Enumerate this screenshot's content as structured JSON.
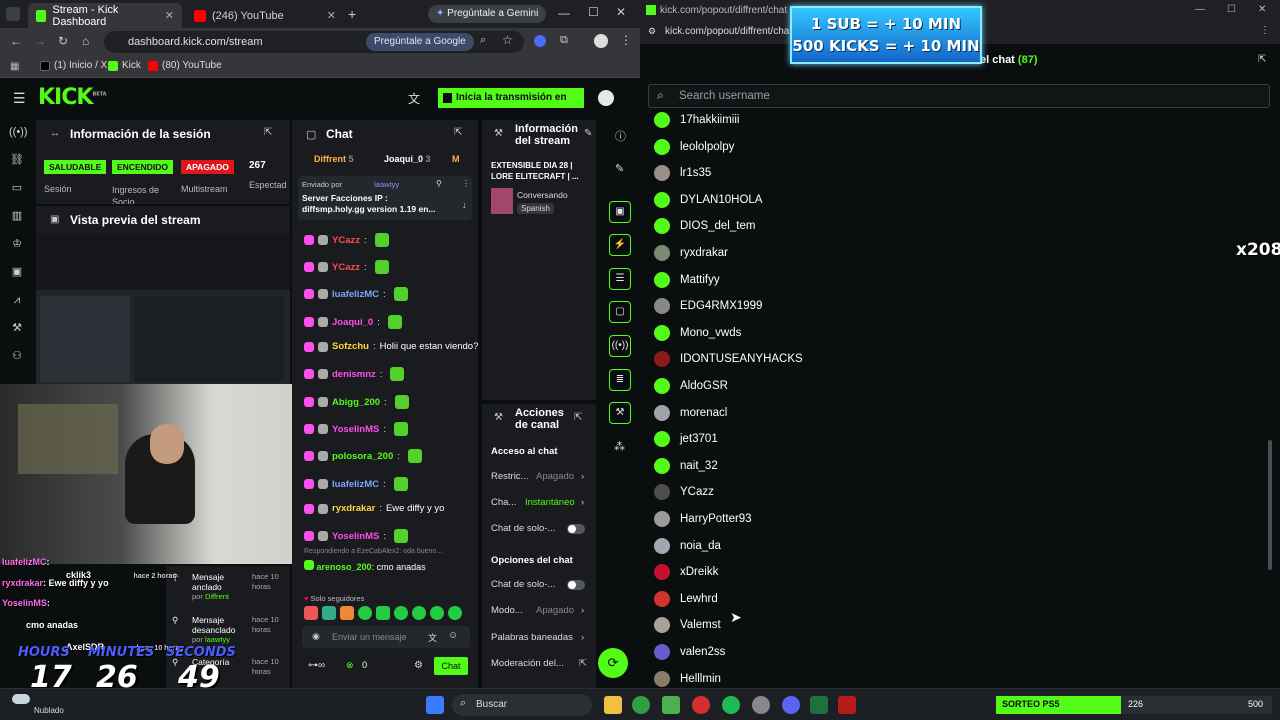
{
  "left_browser": {
    "tabs": [
      {
        "label": "Stream - Kick Dashboard",
        "icon": "kick-icon"
      },
      {
        "label": "(246) YouTube",
        "icon": "youtube-icon"
      }
    ],
    "gemini_label": "Pregúntale a Gemini",
    "url": "dashboard.kick.com/stream",
    "google_label": "Pregúntale a Google",
    "bookmarks": [
      "(1) Inicio / X",
      "Kick",
      "(80) YouTube"
    ]
  },
  "kick": {
    "logo": "KICK",
    "logo_tag": "BETA",
    "live_button": "Inicia la transmisión en directo",
    "session": {
      "title": "Información de la sesión",
      "badges": [
        {
          "label": "SALUDABLE",
          "caption": "Sesión",
          "color": "#53fc18"
        },
        {
          "label": "ENCENDIDO",
          "caption": "Ingresos de Socio",
          "color": "#53fc18"
        },
        {
          "label": "APAGADO",
          "caption": "Multistream",
          "color": "#e0161d"
        }
      ],
      "viewers": "267",
      "viewers_caption": "Espectad"
    },
    "preview_title": "Vista previa del stream",
    "chat": {
      "title": "Chat",
      "top_users": [
        {
          "name": "Diffrent",
          "count": "5"
        },
        {
          "name": "Joaqui_0",
          "count": "3"
        },
        {
          "name": "M",
          "count": ""
        }
      ],
      "pinned_by": "Enviado por",
      "pinned_user": "laawtyy",
      "pinned_text": "Server Facciones IP : diffsmp.holy.gg version 1.19 en...",
      "messages": [
        {
          "user": "YCazz",
          "text": "",
          "color": "#ff4d4d"
        },
        {
          "user": "YCazz",
          "text": "",
          "color": "#ff4d4d"
        },
        {
          "user": "luafelizMC",
          "text": "",
          "color": "#7da7ff"
        },
        {
          "user": "Joaqui_0",
          "text": "",
          "color": "#ff4df0"
        },
        {
          "user": "Sofzchu",
          "text": "Holii que estan viendo?",
          "color": "#ffd93b"
        },
        {
          "user": "denismnz",
          "text": "",
          "color": "#ff4df0"
        },
        {
          "user": "Abigg_200",
          "text": "",
          "color": "#53fc18"
        },
        {
          "user": "YoselinMS",
          "text": "",
          "color": "#ff4df0"
        },
        {
          "user": "polosora_200",
          "text": "",
          "color": "#53fc18"
        },
        {
          "user": "luafelizMC",
          "text": "",
          "color": "#7da7ff"
        },
        {
          "user": "ryxdrakar",
          "text": "Ewe diffy y yo",
          "color": "#ffd93b"
        },
        {
          "user": "YoselinMS",
          "text": "",
          "color": "#ff4df0"
        }
      ],
      "reply_context": "Respondiendo a EzeCabAlex2: oda bueno...",
      "reply_user": "arenoso_200",
      "reply_text": "cmo anadas",
      "followers_only": "Solo seguidores",
      "input_placeholder": "Enviar un mensaje",
      "points": "0",
      "send_label": "Chat"
    },
    "stream_info": {
      "title": "Información del stream",
      "stream_title": "EXTENSIBLE DIA 28 | LORE ELITECRAFT | ...",
      "category": "Conversando",
      "language": "Spanish"
    },
    "actions": {
      "title": "Acciones de canal",
      "access_title": "Acceso al chat",
      "rows": [
        {
          "label": "Restric...",
          "value": "Apagado"
        },
        {
          "label": "Cha...",
          "value": "Instantáneo"
        }
      ],
      "subs_label": "Chat de solo-...",
      "options_title": "Opciones del chat",
      "opt_rows": [
        {
          "label": "Chat de solo-...",
          "value": ""
        },
        {
          "label": "Modo...",
          "value": "Apagado"
        },
        {
          "label": "Palabras baneadas",
          "value": ""
        },
        {
          "label": "Moderación del...",
          "value": ""
        }
      ]
    },
    "activity": [
      {
        "title": "Mensaje anclado",
        "by": "por",
        "user": "Diffrent",
        "time": "hace 10 horas"
      },
      {
        "title": "Mensaje desanclado",
        "by": "por",
        "user": "laawtyy",
        "time": "hace 10 horas"
      },
      {
        "title": "Categoría",
        "by": "",
        "user": "",
        "time": "hace 10 horas"
      }
    ]
  },
  "overlay": {
    "messages": [
      {
        "user": "luafelizMC",
        "text": ""
      },
      {
        "user": "ryxdrakar",
        "text": "Ewe diffy y yo"
      },
      {
        "user": "YoselinMS",
        "text": ""
      },
      {
        "user": "",
        "text": "cmo anadas"
      }
    ],
    "side_messages": [
      {
        "user": "cklik3",
        "text": "hace 2 horas"
      },
      {
        "user": "AxelSDR",
        "text": "hace 10 horas"
      }
    ],
    "hours_label": "HOURS",
    "hours": "17",
    "minutes_label": "MINUTES",
    "minutes": "26",
    "seconds_label": "SECONDS",
    "seconds": "49",
    "weather": "Nublado"
  },
  "right_browser": {
    "title": "kick.com/popout/diffrent/chat - Goo",
    "url": "kick.com/popout/diffrent/chat",
    "promo_line1": "1 SUB = + 10 MIN",
    "promo_line2": "500 KICKS = + 10 MIN",
    "chatters_label": "el chat",
    "chatters_count": "(87)",
    "search_placeholder": "Search username",
    "combo": "x208",
    "users": [
      {
        "name": "17hakkiimiii",
        "color": "#53fc18"
      },
      {
        "name": "leololpolpy",
        "color": "#53fc18"
      },
      {
        "name": "lr1s35",
        "color": "#9a8f8a"
      },
      {
        "name": "DYLAN10HOLA",
        "color": "#53fc18"
      },
      {
        "name": "DIOS_del_tem",
        "color": "#53fc18"
      },
      {
        "name": "ryxdrakar",
        "color": "#7a8a70"
      },
      {
        "name": "Mattifyy",
        "color": "#53fc18"
      },
      {
        "name": "EDG4RMX1999",
        "color": "#888888"
      },
      {
        "name": "Mono_vwds",
        "color": "#53fc18"
      },
      {
        "name": "IDONTUSEANYHACKS",
        "color": "#8b1a1a"
      },
      {
        "name": "AldoGSR",
        "color": "#53fc18"
      },
      {
        "name": "morenacl",
        "color": "#9da3a8"
      },
      {
        "name": "jet3701",
        "color": "#53fc18"
      },
      {
        "name": "nait_32",
        "color": "#53fc18"
      },
      {
        "name": "YCazz",
        "color": "#4d4d4d"
      },
      {
        "name": "HarryPotter93",
        "color": "#9a9a9a"
      },
      {
        "name": "noia_da",
        "color": "#a0a8b0"
      },
      {
        "name": "xDreikk",
        "color": "#c8102e"
      },
      {
        "name": "Lewhrd",
        "color": "#d0342c"
      },
      {
        "name": "Valemst",
        "color": "#a8a29b"
      },
      {
        "name": "valen2ss",
        "color": "#6a5acd"
      },
      {
        "name": "Helllmin",
        "color": "#8a7a6a"
      }
    ]
  },
  "taskbar": {
    "search_label": "Buscar",
    "sorteo_label": "SORTEO PS5",
    "sorteo_value": "226",
    "sorteo_goal": "500",
    "sorteo_progress": 0.452
  }
}
